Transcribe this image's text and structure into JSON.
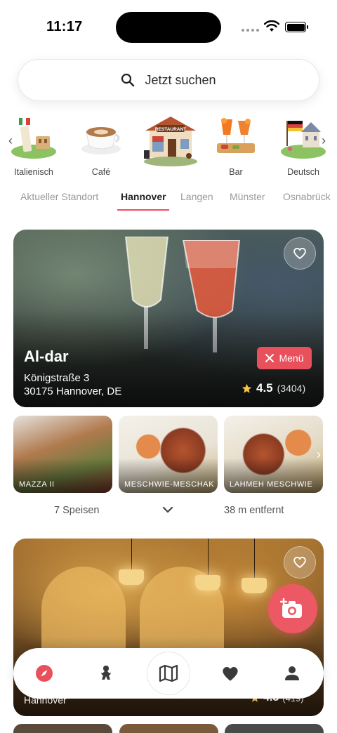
{
  "status_bar": {
    "time": "11:17"
  },
  "search": {
    "placeholder": "Jetzt suchen"
  },
  "categories": [
    {
      "label": "Italienisch",
      "icon": "leaning-tower-icon"
    },
    {
      "label": "Café",
      "icon": "coffee-cup-icon"
    },
    {
      "label": "",
      "icon": "restaurant-building-icon",
      "sign": "RESTAURANT"
    },
    {
      "label": "Bar",
      "icon": "cocktail-icon"
    },
    {
      "label": "Deutsch",
      "icon": "german-castle-icon"
    }
  ],
  "city_tabs": [
    {
      "label": "Aktueller Standort",
      "active": false
    },
    {
      "label": "Hannover",
      "active": true
    },
    {
      "label": "Langen",
      "active": false
    },
    {
      "label": "Münster",
      "active": false
    },
    {
      "label": "Osnabrück",
      "active": false
    }
  ],
  "restaurant": {
    "name": "Al-dar",
    "street": "Königstraße 3",
    "city_line": "30175 Hannover, DE",
    "menu_label": "Menü",
    "rating": "4.5",
    "rating_count": "(3404)",
    "dishes": [
      {
        "label": "MAZZA II"
      },
      {
        "label": "MESCHWIE-MESCHAKAL"
      },
      {
        "label": "LAHMEH MESCHWIE"
      }
    ],
    "dish_count": "7 Speisen",
    "distance": "38 m entfernt"
  },
  "restaurant2": {
    "city": "Hannover",
    "rating": "4.5",
    "rating_count": "(419)"
  },
  "colors": {
    "accent": "#e8505b",
    "fab": "#ec5964"
  },
  "bottom_nav": [
    {
      "icon": "compass-icon",
      "active": true
    },
    {
      "icon": "chef-icon",
      "active": false
    },
    {
      "icon": "map-icon",
      "active": false
    },
    {
      "icon": "heart-icon",
      "active": false
    },
    {
      "icon": "profile-icon",
      "active": false
    }
  ]
}
